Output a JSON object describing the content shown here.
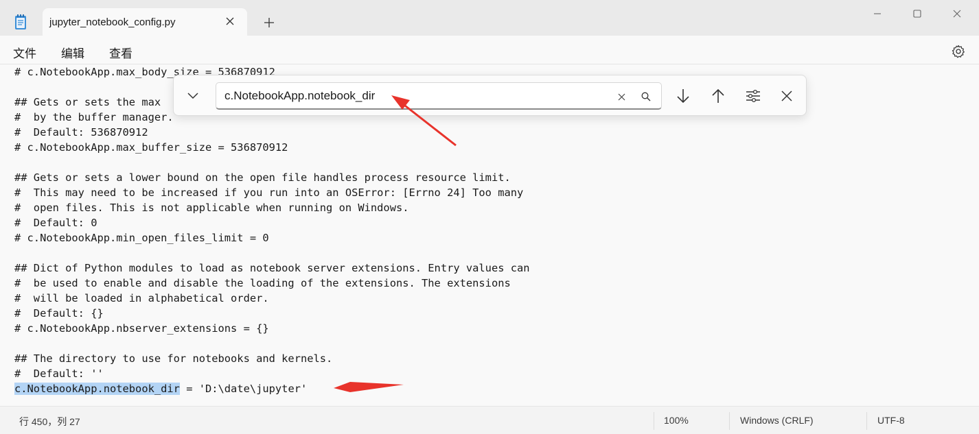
{
  "window": {
    "tab_title": "jupyter_notebook_config.py"
  },
  "menu": {
    "items": [
      "文件",
      "编辑",
      "查看"
    ]
  },
  "find": {
    "query": "c.NotebookApp.notebook_dir"
  },
  "code_lines": [
    "# c.NotebookApp.max_body_size = 536870912",
    "",
    "## Gets or sets the max",
    "#  by the buffer manager.",
    "#  Default: 536870912",
    "# c.NotebookApp.max_buffer_size = 536870912",
    "",
    "## Gets or sets a lower bound on the open file handles process resource limit.",
    "#  This may need to be increased if you run into an OSError: [Errno 24] Too many",
    "#  open files. This is not applicable when running on Windows.",
    "#  Default: 0",
    "# c.NotebookApp.min_open_files_limit = 0",
    "",
    "## Dict of Python modules to load as notebook server extensions. Entry values can",
    "#  be used to enable and disable the loading of the extensions. The extensions",
    "#  will be loaded in alphabetical order.",
    "#  Default: {}",
    "# c.NotebookApp.nbserver_extensions = {}",
    "",
    "## The directory to use for notebooks and kernels.",
    "#  Default: ''"
  ],
  "last_line": {
    "highlight": "c.NotebookApp.notebook_dir",
    "rest": " = 'D:\\date\\jupyter'"
  },
  "status": {
    "position": "行 450，列 27",
    "zoom": "100%",
    "line_ending": "Windows (CRLF)",
    "encoding": "UTF-8"
  },
  "colors": {
    "annotation_arrow": "#e8332b",
    "selection": "#b3d4f5"
  }
}
